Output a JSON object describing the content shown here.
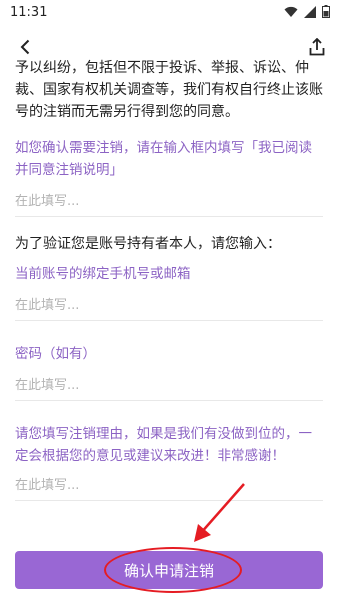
{
  "status_bar": {
    "time": "11:31"
  },
  "terms_text": "予以纠纷，包括但不限于投诉、举报、诉讼、仲裁、国家有权机关调查等，我们有权自行终止该账号的注销而无需另行得到您的同意。",
  "confirm_prompt": "如您确认需要注销，请在输入框内填写「我已阅读并同意注销说明」",
  "field_placeholder": "在此填写...",
  "verify_heading": "为了验证您是账号持有者本人，请您输入：",
  "phone_label": "当前账号的绑定手机号或邮箱",
  "password_label": "密码（如有）",
  "reason_prompt": "请您填写注销理由，如果是我们有没做到位的，一定会根据您的意见或建议来改进！非常感谢！",
  "confirm_button": "确认申请注销",
  "colors": {
    "accent": "#9967d4",
    "label_purple": "#8c63c4",
    "annotation_red": "#e51c23"
  }
}
